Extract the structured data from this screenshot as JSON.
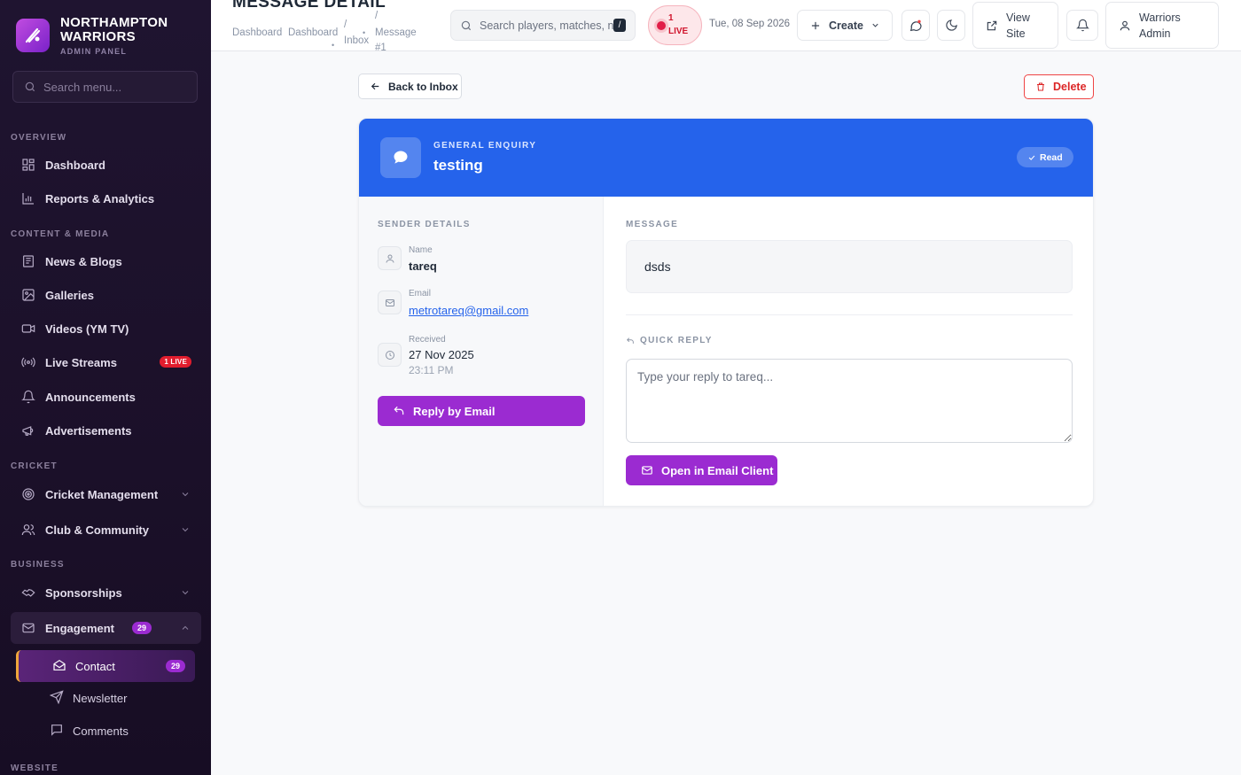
{
  "brand": {
    "name_line1": "NORTHAMPTON",
    "name_line2": "WARRIORS",
    "subtitle": "ADMIN PANEL"
  },
  "sidebar": {
    "search_placeholder": "Search menu...",
    "sections": {
      "overview": "OVERVIEW",
      "content": "CONTENT & MEDIA",
      "cricket": "CRICKET",
      "business": "BUSINESS",
      "website": "WEBSITE"
    },
    "items": {
      "dashboard": "Dashboard",
      "reports": "Reports & Analytics",
      "news": "News & Blogs",
      "galleries": "Galleries",
      "videos": "Videos (YM TV)",
      "live_streams": "Live Streams",
      "live_badge": "1 LIVE",
      "announcements": "Announcements",
      "advertisements": "Advertisements",
      "cricket_mgmt": "Cricket Management",
      "club": "Club & Community",
      "sponsorships": "Sponsorships",
      "engagement": "Engagement",
      "engagement_count": "29",
      "contact": "Contact",
      "contact_count": "29",
      "newsletter": "Newsletter",
      "comments": "Comments"
    }
  },
  "topbar": {
    "title": "MESSAGE DETAIL",
    "breadcrumb": {
      "c1": "Dashboard",
      "c2": "Dashboard",
      "c3": "Inbox",
      "c4": "Message",
      "c5": "#1",
      "sep": "/"
    },
    "search_placeholder": "Search players, matches, news...",
    "search_kbd": "/",
    "live_count": "1",
    "live_label": "LIVE",
    "date": "Tue, 08 Sep 2026",
    "create": "Create",
    "view_site_1": "View",
    "view_site_2": "Site",
    "user_1": "Warriors",
    "user_2": "Admin"
  },
  "actions": {
    "back": "Back to Inbox",
    "delete": "Delete"
  },
  "message": {
    "category": "GENERAL ENQUIRY",
    "subject": "testing",
    "status": "Read",
    "sender_heading": "SENDER DETAILS",
    "name_label": "Name",
    "name": "tareq",
    "email_label": "Email",
    "email": "metrotareq@gmail.com",
    "received_label": "Received",
    "received_date": "27 Nov 2025",
    "received_time": "23:11 PM",
    "reply_by_email": "Reply by Email",
    "message_heading": "MESSAGE",
    "body": "dsds",
    "quick_reply_heading": "QUICK REPLY",
    "reply_placeholder": "Type your reply to tareq...",
    "open_email_client": "Open in Email Client"
  },
  "colors": {
    "accent": "#9b2bd1",
    "header_blue": "#2563eb",
    "sidebar_bg": "#1f1430",
    "live_red": "#e11d2e",
    "delete_red": "#dc2626"
  }
}
